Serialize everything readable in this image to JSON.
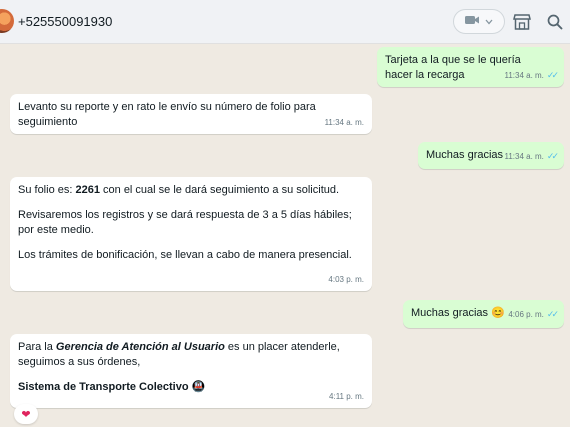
{
  "header": {
    "contact_name": "+525550091930",
    "icons": [
      "avatar",
      "video-call-icon",
      "chevron-down-icon",
      "store-icon",
      "search-icon"
    ]
  },
  "messages": {
    "m1": {
      "text": "Tarjeta a la que se le quería hacer la recarga",
      "time": "11:34 a. m."
    },
    "m2": {
      "text": "Levanto su reporte y en rato le envío su número de folio para seguimiento",
      "time": "11:34 a. m."
    },
    "m3": {
      "text": "Muchas gracias",
      "time": "11:34 a. m."
    },
    "m4": {
      "p1_prefix": "Su folio es: ",
      "p1_folio": "2261",
      "p1_suffix": " con el cual se le dará seguimiento a su solicitud.",
      "p2": "Revisaremos los registros y se dará respuesta de 3 a 5 días hábiles; por este medio.",
      "p3": "Los trámites de bonificación, se llevan a cabo de manera presencial.",
      "time": "4:03 p. m."
    },
    "m5": {
      "text": "Muchas gracias",
      "emoji": "😊",
      "time": "4:06 p. m."
    },
    "m6": {
      "p1_prefix": "Para la ",
      "p1_bold": "Gerencia de Atención al Usuario",
      "p1_suffix": " es un placer atenderle, seguimos a sus órdenes,",
      "p2_bold": "Sistema de Transporte Colectivo",
      "p2_emoji": "🚇",
      "time": "4:11 p. m."
    },
    "reaction": "❤"
  },
  "colors": {
    "outgoing_bubble": "#d9fdd3",
    "incoming_bubble": "#ffffff",
    "chat_background": "#efeae2",
    "read_ticks": "#53bdeb"
  }
}
